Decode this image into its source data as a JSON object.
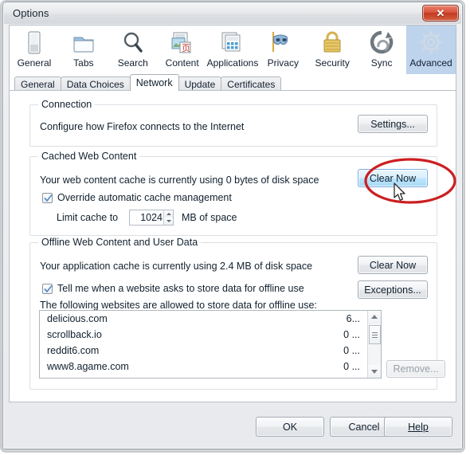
{
  "window": {
    "title": "Options",
    "close_label": "✕",
    "close_icon": "close-icon"
  },
  "toolbar": {
    "items": [
      {
        "label": "General",
        "icon": "general-icon",
        "selected": false
      },
      {
        "label": "Tabs",
        "icon": "tabs-icon",
        "selected": false
      },
      {
        "label": "Search",
        "icon": "search-icon",
        "selected": false
      },
      {
        "label": "Content",
        "icon": "content-icon",
        "selected": false
      },
      {
        "label": "Applications",
        "icon": "applications-icon",
        "selected": false
      },
      {
        "label": "Privacy",
        "icon": "privacy-mask-icon",
        "selected": false
      },
      {
        "label": "Security",
        "icon": "padlock-icon",
        "selected": false
      },
      {
        "label": "Sync",
        "icon": "sync-icon",
        "selected": false
      },
      {
        "label": "Advanced",
        "icon": "gear-icon",
        "selected": true
      }
    ]
  },
  "tabs": [
    {
      "label": "General",
      "active": false
    },
    {
      "label": "Data Choices",
      "active": false
    },
    {
      "label": "Network",
      "active": true
    },
    {
      "label": "Update",
      "active": false
    },
    {
      "label": "Certificates",
      "active": false
    }
  ],
  "connection": {
    "group_title": "Connection",
    "description": "Configure how Firefox connects to the Internet",
    "settings_button": "Settings..."
  },
  "cached_web_content": {
    "group_title": "Cached Web Content",
    "usage_text": "Your web content cache is currently using 0 bytes of disk space",
    "clear_button": "Clear Now",
    "override_checkbox_label": "Override automatic cache management",
    "override_checked": true,
    "limit_label": "Limit cache to",
    "limit_value": "1024",
    "limit_units": "MB of space"
  },
  "offline_web_content": {
    "group_title": "Offline Web Content and User Data",
    "usage_text": "Your application cache is currently using 2.4 MB of disk space",
    "clear_button": "Clear Now",
    "tell_me_checkbox_label": "Tell me when a website asks to store data for offline use",
    "tell_me_checked": true,
    "exceptions_button": "Exceptions...",
    "list_label": "The following websites are allowed to store data for offline use:",
    "sites": [
      {
        "host": "delicious.com",
        "size": "6..."
      },
      {
        "host": "scrollback.io",
        "size": "0 ..."
      },
      {
        "host": "reddit6.com",
        "size": "0 ..."
      },
      {
        "host": "www8.agame.com",
        "size": "0 ..."
      }
    ],
    "remove_button": "Remove...",
    "remove_disabled": true
  },
  "footer": {
    "ok": "OK",
    "cancel": "Cancel",
    "help": "Help"
  },
  "annotation": {
    "shape": "red-ellipse-highlight",
    "color": "#cc1f22",
    "target": "Clear Now"
  },
  "colors": {
    "accent_selected_tab": "#bed3ec",
    "annotation_red": "#cc1f22",
    "close_red": "#c43a23"
  }
}
